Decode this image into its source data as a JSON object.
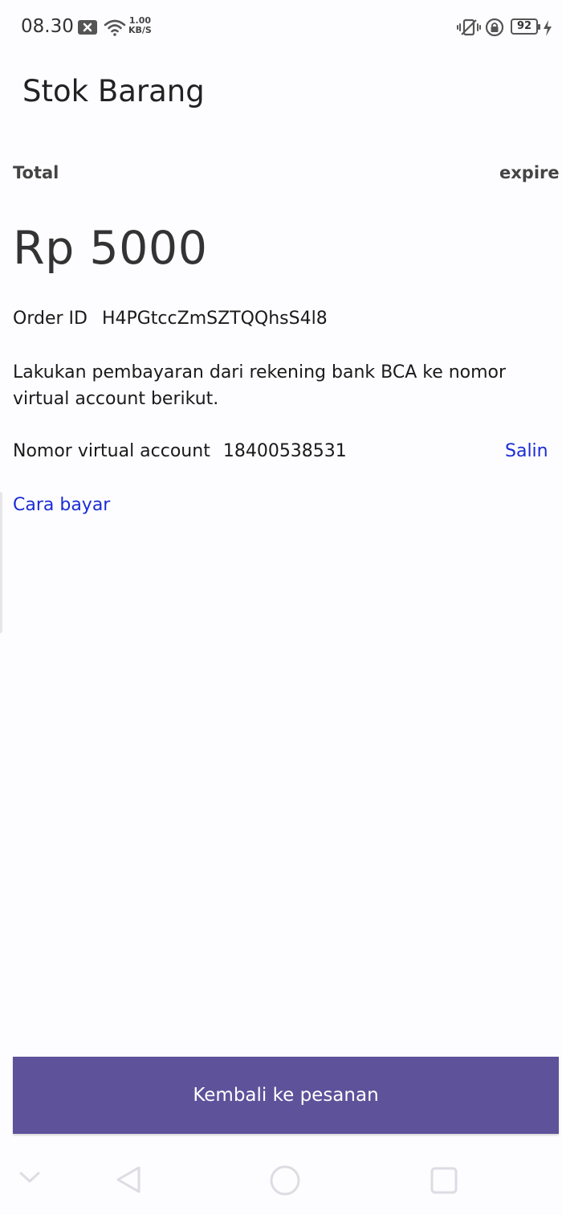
{
  "status_bar": {
    "time": "08.30",
    "net_speed_value": "1.00",
    "net_speed_unit": "KB/S",
    "battery": "92"
  },
  "header": {
    "title": "Stok Barang"
  },
  "payment": {
    "total_label": "Total",
    "expire_label": "expire",
    "amount": "Rp 5000",
    "order_id_label": "Order ID",
    "order_id_value": "H4PGtccZmSZTQQhsS4l8",
    "instruction": "Lakukan pembayaran dari rekening bank BCA ke nomor virtual account berikut.",
    "va_label": "Nomor virtual account",
    "va_number": "18400538531",
    "copy_label": "Salin",
    "how_to_pay_label": "Cara bayar"
  },
  "footer": {
    "back_button_label": "Kembali ke pesanan"
  },
  "colors": {
    "primary_button": "#5e529a",
    "link": "#1a2bd6"
  },
  "nav_bar": {
    "icons": [
      "chevron-down-icon",
      "back-triangle-icon",
      "home-circle-icon",
      "recents-square-icon"
    ]
  }
}
